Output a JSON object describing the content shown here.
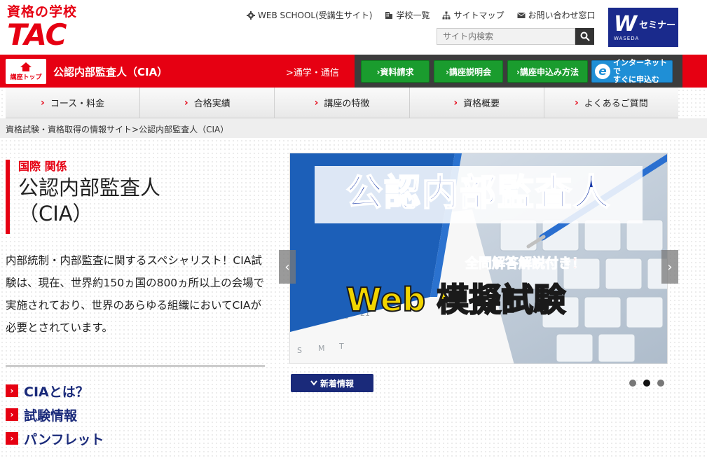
{
  "logo": {
    "top": "資格の学校",
    "main": "TAC"
  },
  "top_links": [
    {
      "label": "WEB SCHOOL(受講生サイト)",
      "icon": "gear-icon"
    },
    {
      "label": "学校一覧",
      "icon": "building-icon"
    },
    {
      "label": "サイトマップ",
      "icon": "sitemap-icon"
    },
    {
      "label": "お問い合わせ窓口",
      "icon": "mail-icon"
    }
  ],
  "search": {
    "placeholder": "サイト内検索"
  },
  "waseda": {
    "letter": "W",
    "text": "セミナー",
    "sub": "WASEDA"
  },
  "redbar": {
    "home_label": "講座トップ",
    "course_title": "公認内部監査人（CIA）",
    "mode_link": ">通学・通信",
    "buttons": [
      "›資料請求",
      "›講座説明会",
      "›講座申込み方法"
    ],
    "internet_btn": {
      "icon": "e",
      "line1": "インターネットで",
      "line2": "すぐに申込む"
    }
  },
  "nav": [
    "コース・料金",
    "合格実績",
    "講座の特徴",
    "資格概要",
    "よくあるご質問"
  ],
  "breadcrumb": {
    "link": "資格試験・資格取得の情報サイト",
    "current": ">公認内部監査人（CIA）"
  },
  "heading": {
    "category": "国際 関係",
    "title_line1": "公認内部監査人",
    "title_line2": "（CIA）"
  },
  "description": "内部統制・内部監査に関するスペシャリスト！CIA試験は、現在、世界約150ヵ国の800ヵ所以上の会場で実施されており、世界のあらゆる組織においてCIAが必要とされています。",
  "side_links": [
    "CIAとは？",
    "試験情報",
    "パンフレット"
  ],
  "slider": {
    "headline": "公認内部監査人",
    "sub": "全問解答解説付き！",
    "main": "Web 模擬試験",
    "prev": "‹",
    "next": "›",
    "active_slide": 2,
    "slide_count": 3
  },
  "news_button": "新着情報",
  "colors": {
    "brand_red": "#e60012",
    "navy": "#1a2a7a",
    "green": "#1a9c2e",
    "blue": "#1f8fd6"
  }
}
